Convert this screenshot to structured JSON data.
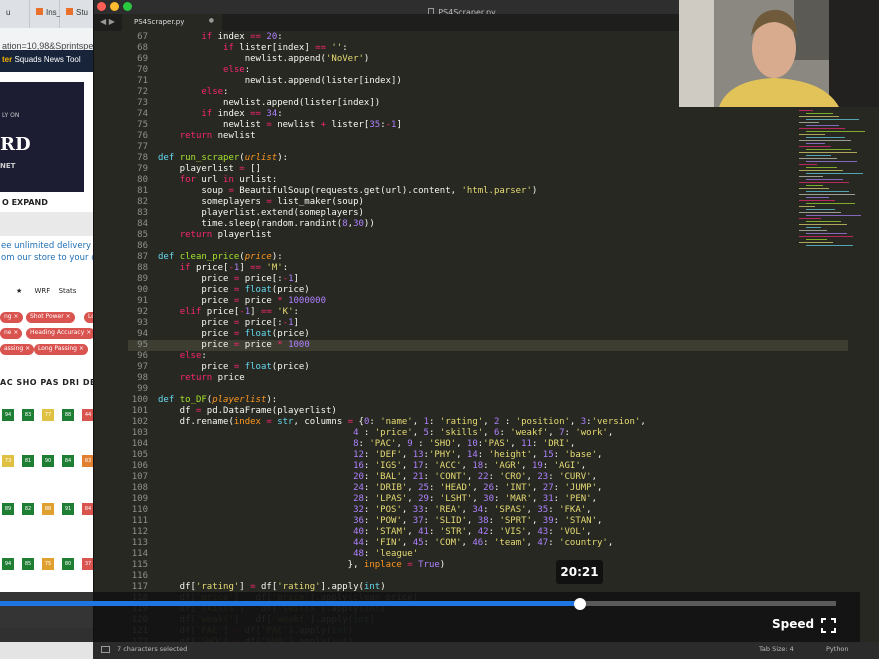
{
  "browser": {
    "tabs": [
      {
        "label": "u"
      },
      {
        "label": "Ins_"
      },
      {
        "label": "Stu"
      }
    ],
    "url": "ation=10,98&Sprintspee",
    "nav": {
      "active": "ter",
      "items": [
        "Squads",
        "News",
        "Tool"
      ]
    },
    "ad": {
      "line1": "LY ON",
      "brand": "RD",
      "line3": "NET"
    },
    "expand_label": "O EXPAND",
    "delivery_line1": "ee unlimited delivery",
    "delivery_line2": "om our store to your d",
    "filters": [
      "★",
      "WRF",
      "Stats"
    ],
    "chips": [
      "ng",
      "Shot Power",
      "Lo",
      "ne",
      "Heading Accuracy",
      "assing",
      "Long Passing"
    ],
    "stat_header": "AC SHO PAS DRI DEF",
    "stat_rows": [
      {
        "cells": [
          "94",
          "83",
          "77",
          "88",
          "44"
        ],
        "colors": [
          "#1e7e34",
          "#1e7e34",
          "#e0c040",
          "#1e7e34",
          "#d9534f"
        ]
      },
      {
        "cells": [
          "73",
          "81",
          "90",
          "84",
          "83"
        ],
        "colors": [
          "#e0c040",
          "#1e7e34",
          "#1e7e34",
          "#1e7e34",
          "#e08030"
        ]
      },
      {
        "cells": [
          "89",
          "82",
          "88",
          "91",
          "84"
        ],
        "colors": [
          "#1e7e34",
          "#1e7e34",
          "#e0a030",
          "#1e7e34",
          "#d9534f"
        ]
      },
      {
        "cells": [
          "94",
          "85",
          "75",
          "80",
          "37"
        ],
        "colors": [
          "#1e7e34",
          "#1e7e34",
          "#e0a030",
          "#1e7e34",
          "#d9534f"
        ]
      }
    ]
  },
  "editor": {
    "window_title": "PS4Scraper.py",
    "tab_label": "PS4Scraper.py",
    "tab_nav": "◀ ▶",
    "tab_close": "●",
    "current_line": 95,
    "lines": [
      {
        "n": "67",
        "t": "        if index == 20:"
      },
      {
        "n": "68",
        "t": "            if lister[index] == '':"
      },
      {
        "n": "69",
        "t": "                newlist.append('NoVer')"
      },
      {
        "n": "70",
        "t": "            else:"
      },
      {
        "n": "71",
        "t": "                newlist.append(lister[index])"
      },
      {
        "n": "72",
        "t": "        else:"
      },
      {
        "n": "73",
        "t": "            newlist.append(lister[index])"
      },
      {
        "n": "74",
        "t": "        if index == 34:"
      },
      {
        "n": "75",
        "t": "            newlist = newlist + lister[35:-1]"
      },
      {
        "n": "76",
        "t": "    return newlist"
      },
      {
        "n": "77",
        "t": ""
      },
      {
        "n": "78",
        "t": "def run_scraper(urlist):"
      },
      {
        "n": "79",
        "t": "    playerlist = []"
      },
      {
        "n": "80",
        "t": "    for url in urlist:"
      },
      {
        "n": "81",
        "t": "        soup = BeautifulSoup(requests.get(url).content, 'html.parser')"
      },
      {
        "n": "82",
        "t": "        someplayers = list_maker(soup)"
      },
      {
        "n": "83",
        "t": "        playerlist.extend(someplayers)"
      },
      {
        "n": "84",
        "t": "        time.sleep(random.randint(8,30))"
      },
      {
        "n": "85",
        "t": "    return playerlist"
      },
      {
        "n": "86",
        "t": ""
      },
      {
        "n": "87",
        "t": "def clean_price(price):"
      },
      {
        "n": "88",
        "t": "    if price[-1] == 'M':"
      },
      {
        "n": "89",
        "t": "        price = price[:-1]"
      },
      {
        "n": "90",
        "t": "        price = float(price)"
      },
      {
        "n": "91",
        "t": "        price = price * 1000000"
      },
      {
        "n": "92",
        "t": "    elif price[-1] == 'K':"
      },
      {
        "n": "93",
        "t": "        price = price[:-1]"
      },
      {
        "n": "94",
        "t": "        price = float(price)"
      },
      {
        "n": "95",
        "t": "        price = price * 1000"
      },
      {
        "n": "96",
        "t": "    else:"
      },
      {
        "n": "97",
        "t": "        price = float(price)"
      },
      {
        "n": "98",
        "t": "    return price"
      },
      {
        "n": "99",
        "t": ""
      },
      {
        "n": "100",
        "t": "def to_DF(playerlist):"
      },
      {
        "n": "101",
        "t": "    df = pd.DataFrame(playerlist)"
      },
      {
        "n": "102",
        "t": "    df.rename(index = str, columns = {0: 'name', 1: 'rating', 2 : 'position', 3:'version',"
      },
      {
        "n": "103",
        "t": "                                    4 : 'price', 5: 'skills', 6: 'weakf', 7: 'work',"
      },
      {
        "n": "104",
        "t": "                                    8: 'PAC', 9 : 'SHO', 10:'PAS', 11: 'DRI',"
      },
      {
        "n": "105",
        "t": "                                    12: 'DEF', 13:'PHY', 14: 'height', 15: 'base',"
      },
      {
        "n": "106",
        "t": "                                    16: 'IGS', 17: 'ACC', 18: 'AGR', 19: 'AGI',"
      },
      {
        "n": "107",
        "t": "                                    20: 'BAL', 21: 'CONT', 22: 'CRO', 23: 'CURV',"
      },
      {
        "n": "108",
        "t": "                                    24: 'DRIB', 25: 'HEAD', 26: 'INT', 27: 'JUMP',"
      },
      {
        "n": "109",
        "t": "                                    28: 'LPAS', 29: 'LSHT', 30: 'MAR', 31: 'PEN',"
      },
      {
        "n": "110",
        "t": "                                    32: 'POS', 33: 'REA', 34: 'SPAS', 35: 'FKA',"
      },
      {
        "n": "111",
        "t": "                                    36: 'POW', 37: 'SLID', 38: 'SPRT', 39: 'STAN',"
      },
      {
        "n": "112",
        "t": "                                    40: 'STAM', 41: 'STR', 42: 'VIS', 43: 'VOL',"
      },
      {
        "n": "113",
        "t": "                                    44: 'FIN', 45: 'COM', 46: 'team', 47: 'country',"
      },
      {
        "n": "114",
        "t": "                                    48: 'league'"
      },
      {
        "n": "115",
        "t": "                                   }, inplace = True)"
      },
      {
        "n": "116",
        "t": ""
      },
      {
        "n": "117",
        "t": "    df['rating'] = df['rating'].apply(int)"
      },
      {
        "n": "118",
        "t": "    df['price'] = df['price'].apply(clean_price)"
      },
      {
        "n": "119",
        "t": "    df['skills'] = df['skills'].apply(int)"
      },
      {
        "n": "120",
        "t": "    df['weakf'] = df['weakf'].apply(int)"
      },
      {
        "n": "121",
        "t": "    df['PAC'] = df['PAC'].apply(int)"
      },
      {
        "n": "122",
        "t": "    df['SHO'] = df['SHO'].apply(int)"
      }
    ]
  },
  "status": {
    "selection": "7 characters selected",
    "tab_size": "Tab Size: 4",
    "syntax": "Python"
  },
  "player": {
    "time_tooltip": "20:21",
    "progress": 0.694,
    "speed_label": "Speed",
    "fullscreen_icon": "fullscreen-icon"
  },
  "colors": {
    "keyword": "#f92672",
    "function": "#a6e22e",
    "string": "#e6db74",
    "number": "#ae81ff",
    "builtin": "#66d9ef",
    "param": "#fd971f",
    "accent": "#1e76e3"
  }
}
